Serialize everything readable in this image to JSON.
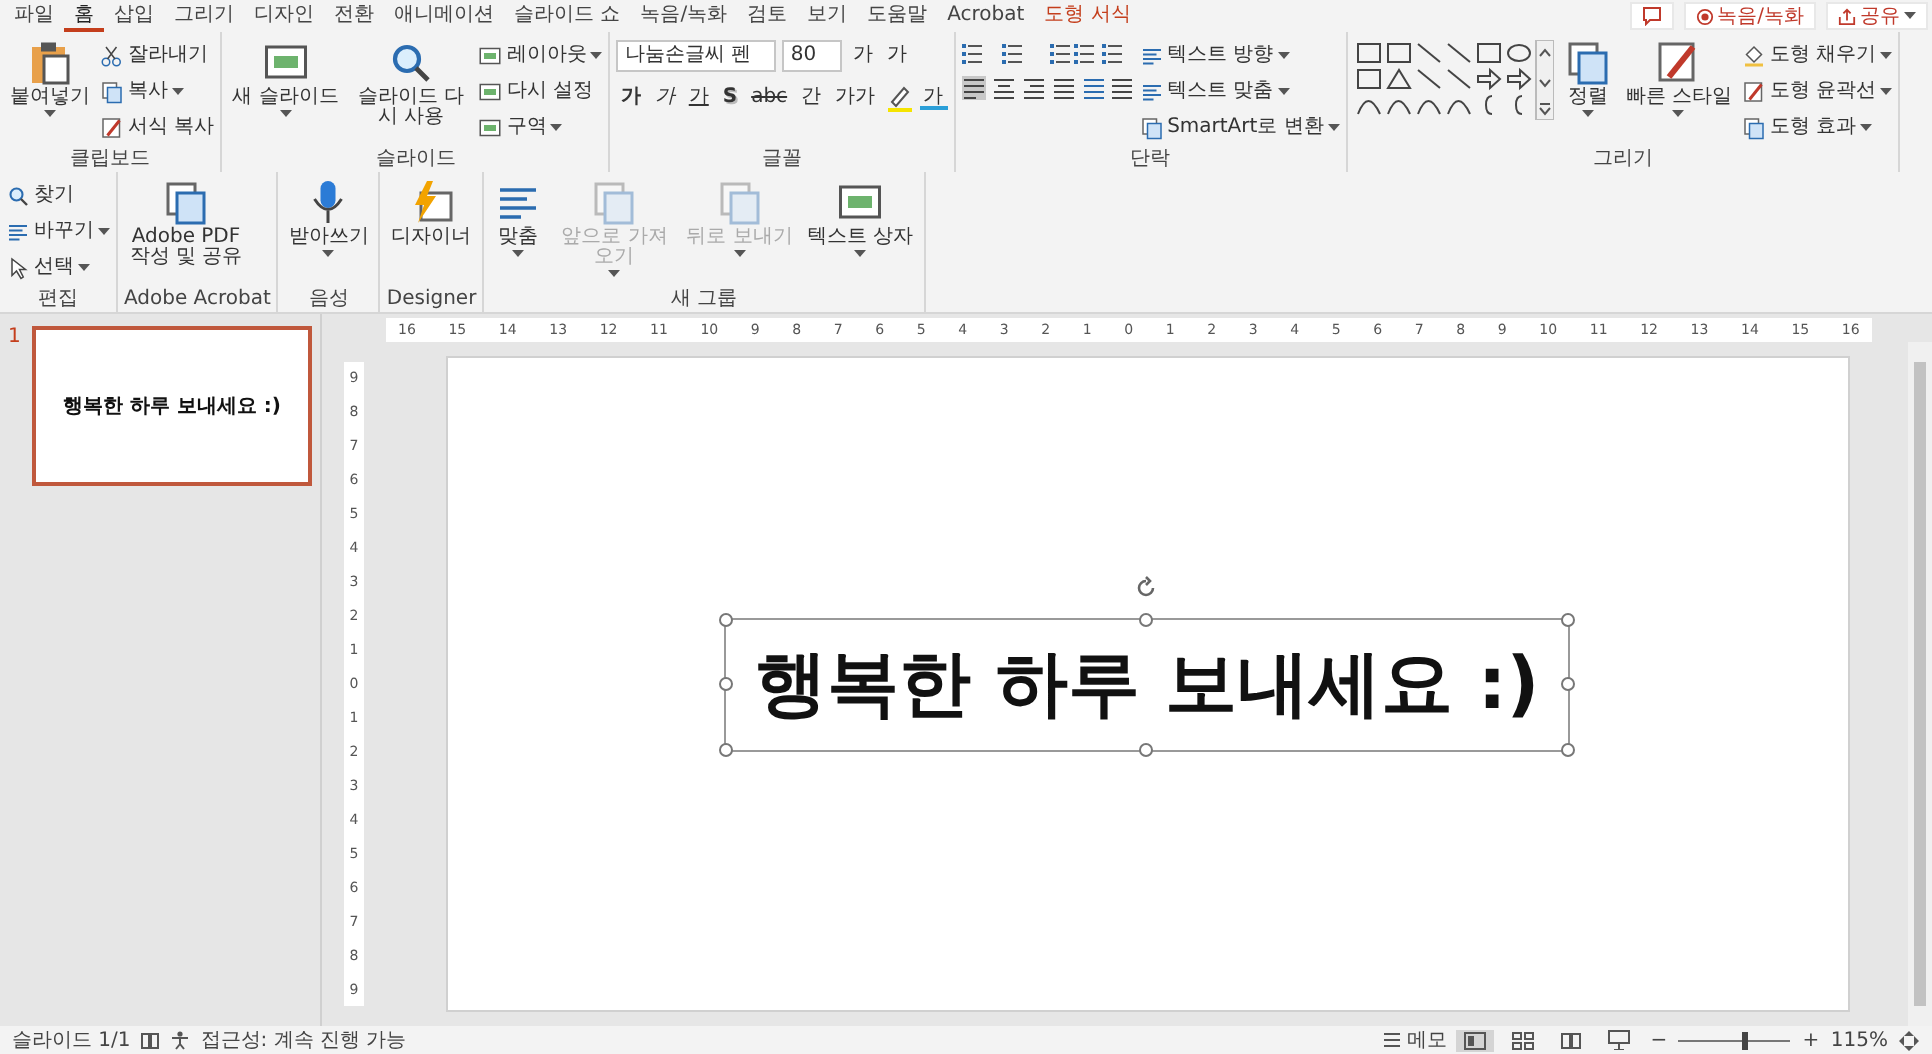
{
  "menu": {
    "tabs": [
      {
        "label": "파일",
        "selected": false,
        "kind": "normal"
      },
      {
        "label": "홈",
        "selected": true,
        "kind": "normal"
      },
      {
        "label": "삽입",
        "selected": false,
        "kind": "normal"
      },
      {
        "label": "그리기",
        "selected": false,
        "kind": "normal"
      },
      {
        "label": "디자인",
        "selected": false,
        "kind": "normal"
      },
      {
        "label": "전환",
        "selected": false,
        "kind": "normal"
      },
      {
        "label": "애니메이션",
        "selected": false,
        "kind": "normal"
      },
      {
        "label": "슬라이드 쇼",
        "selected": false,
        "kind": "normal"
      },
      {
        "label": "녹음/녹화",
        "selected": false,
        "kind": "normal"
      },
      {
        "label": "검토",
        "selected": false,
        "kind": "normal"
      },
      {
        "label": "보기",
        "selected": false,
        "kind": "normal"
      },
      {
        "label": "도움말",
        "selected": false,
        "kind": "normal"
      },
      {
        "label": "Acrobat",
        "selected": false,
        "kind": "normal"
      },
      {
        "label": "도형 서식",
        "selected": false,
        "kind": "contextual"
      }
    ],
    "actions": [
      {
        "kind": "comment"
      },
      {
        "kind": "record",
        "label": "녹음/녹화"
      },
      {
        "kind": "share",
        "label": "공유"
      }
    ]
  },
  "ribbon": [
    {
      "label": "클립보드",
      "columns": [
        {
          "kind": "large",
          "label": "붙여넣기",
          "caret": true,
          "disabled": false
        },
        {
          "kind": "stack",
          "items": [
            {
              "label": "잘라내기",
              "caret": false
            },
            {
              "label": "복사",
              "caret": true
            },
            {
              "label": "서식 복사",
              "caret": false
            }
          ]
        }
      ]
    },
    {
      "label": "슬라이드",
      "columns": [
        {
          "kind": "large",
          "label": "새 슬라이드",
          "caret": true,
          "disabled": false
        },
        {
          "kind": "large",
          "label": "슬라이드 다시 사용",
          "caret": false,
          "disabled": false
        },
        {
          "kind": "stack",
          "items": [
            {
              "label": "레이아웃",
              "caret": true
            },
            {
              "label": "다시 설정",
              "caret": false
            },
            {
              "label": "구역",
              "caret": true
            }
          ]
        }
      ]
    },
    {
      "label": "글꼴",
      "columns": [
        {
          "kind": "font",
          "font": "나눔손글씨 펜",
          "size": "80",
          "grow": "가",
          "shrink": "가",
          "formats": [
            {
              "label": "가",
              "kind": "bold"
            },
            {
              "label": "가",
              "kind": "italic"
            },
            {
              "label": "가",
              "kind": "underline"
            },
            {
              "label": "S",
              "kind": "shadow"
            },
            {
              "label": "abc",
              "kind": "strike"
            },
            {
              "label": "간",
              "kind": "spacing"
            },
            {
              "label": "가가",
              "kind": "case"
            }
          ],
          "color_letter": "가"
        }
      ]
    },
    {
      "label": "단락",
      "columns": [
        {
          "kind": "paragraph"
        },
        {
          "kind": "stack",
          "items": [
            {
              "label": "텍스트 방향",
              "caret": true
            },
            {
              "label": "텍스트 맞춤",
              "caret": true
            },
            {
              "label": "SmartArt로 변환",
              "caret": true
            }
          ]
        }
      ]
    },
    {
      "label": "그리기",
      "columns": [
        {
          "kind": "shapes"
        },
        {
          "kind": "large",
          "label": "정렬",
          "caret": true,
          "disabled": false
        },
        {
          "kind": "large",
          "label": "빠른 스타일",
          "caret": true,
          "disabled": false
        },
        {
          "kind": "stack",
          "items": [
            {
              "label": "도형 채우기",
              "caret": true
            },
            {
              "label": "도형 윤곽선",
              "caret": true
            },
            {
              "label": "도형 효과",
              "caret": true
            }
          ]
        }
      ]
    },
    {
      "label": "편집",
      "columns": [
        {
          "kind": "stack",
          "items": [
            {
              "label": "찾기",
              "caret": false
            },
            {
              "label": "바꾸기",
              "caret": true
            },
            {
              "label": "선택",
              "caret": true
            }
          ]
        }
      ]
    },
    {
      "label": "Adobe Acrobat",
      "columns": [
        {
          "kind": "large",
          "label": "Adobe PDF 작성 및 공유",
          "caret": false,
          "disabled": false
        }
      ]
    },
    {
      "label": "음성",
      "columns": [
        {
          "kind": "large",
          "label": "받아쓰기",
          "caret": true,
          "disabled": false
        }
      ]
    },
    {
      "label": "Designer",
      "columns": [
        {
          "kind": "large",
          "label": "디자이너",
          "caret": false,
          "disabled": false
        }
      ]
    },
    {
      "label": "새 그룹",
      "columns": [
        {
          "kind": "large",
          "label": "맞춤",
          "caret": true,
          "disabled": false
        },
        {
          "kind": "large",
          "label": "앞으로 가져오기",
          "caret": true,
          "disabled": true
        },
        {
          "kind": "large",
          "label": "뒤로 보내기",
          "caret": true,
          "disabled": true
        },
        {
          "kind": "large",
          "label": "텍스트 상자",
          "caret": true,
          "disabled": false
        }
      ]
    }
  ],
  "thumbnails": [
    {
      "number": "1",
      "text": "행복한 하루 보내세요 :)",
      "selected": true
    }
  ],
  "rulers": {
    "horizontal": [
      "16",
      "15",
      "14",
      "13",
      "12",
      "11",
      "10",
      "9",
      "8",
      "7",
      "6",
      "5",
      "4",
      "3",
      "2",
      "1",
      "0",
      "1",
      "2",
      "3",
      "4",
      "5",
      "6",
      "7",
      "8",
      "9",
      "10",
      "11",
      "12",
      "13",
      "14",
      "15",
      "16"
    ],
    "vertical": [
      "9",
      "8",
      "7",
      "6",
      "5",
      "4",
      "3",
      "2",
      "1",
      "0",
      "1",
      "2",
      "3",
      "4",
      "5",
      "6",
      "7",
      "8",
      "9"
    ]
  },
  "slide": {
    "text": "행복한 하루 보내세요 :)",
    "selected": true
  },
  "status_bar": {
    "slide": "슬라이드 1/1",
    "accessibility": "접근성: 계속 진행 가능",
    "notes": "메모",
    "views": [
      {
        "kind": "normal",
        "selected": true
      },
      {
        "kind": "sorter",
        "selected": false
      },
      {
        "kind": "reading",
        "selected": false
      },
      {
        "kind": "show",
        "selected": false
      }
    ],
    "zoom_out": "−",
    "zoom_in": "+",
    "zoom": {
      "level": 0.58
    },
    "zoom_text": "115%"
  }
}
